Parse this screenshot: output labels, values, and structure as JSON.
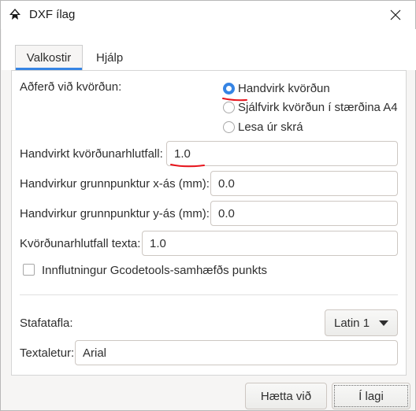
{
  "window": {
    "title": "DXF ílag",
    "icon": "inkscape-icon",
    "close_icon": "close-icon"
  },
  "tabs": [
    {
      "label": "Valkostir",
      "active": true
    },
    {
      "label": "Hjálp",
      "active": false
    }
  ],
  "form": {
    "scaling_method_label": "Aðferð við kvörðun:",
    "scaling_options": [
      {
        "label": "Handvirk kvörðun",
        "selected": true
      },
      {
        "label": "Sjálfvirk kvörðun í stærðina A4",
        "selected": false
      },
      {
        "label": "Lesa úr skrá",
        "selected": false
      }
    ],
    "manual_scale_label": "Handvirkt kvörðunarhlutfall:",
    "manual_scale_value": "1.0",
    "origin_x_label": "Handvirkur grunnpunktur x-ás (mm):",
    "origin_x_value": "0.0",
    "origin_y_label": "Handvirkur grunnpunktur y-ás (mm):",
    "origin_y_value": "0.0",
    "text_scale_label": "Kvörðunarhlutfall texta:",
    "text_scale_value": "1.0",
    "gcodetools_label": "Innflutningur Gcodetools-samhæfðs punkts",
    "gcodetools_checked": false,
    "charset_label": "Stafatafla:",
    "charset_value": "Latin 1",
    "font_label": "Textaletur:",
    "font_value": "Arial"
  },
  "buttons": {
    "cancel": "Hætta við",
    "ok": "Í lagi"
  },
  "colors": {
    "accent": "#3584e4",
    "annotation_red": "#e8141c"
  }
}
